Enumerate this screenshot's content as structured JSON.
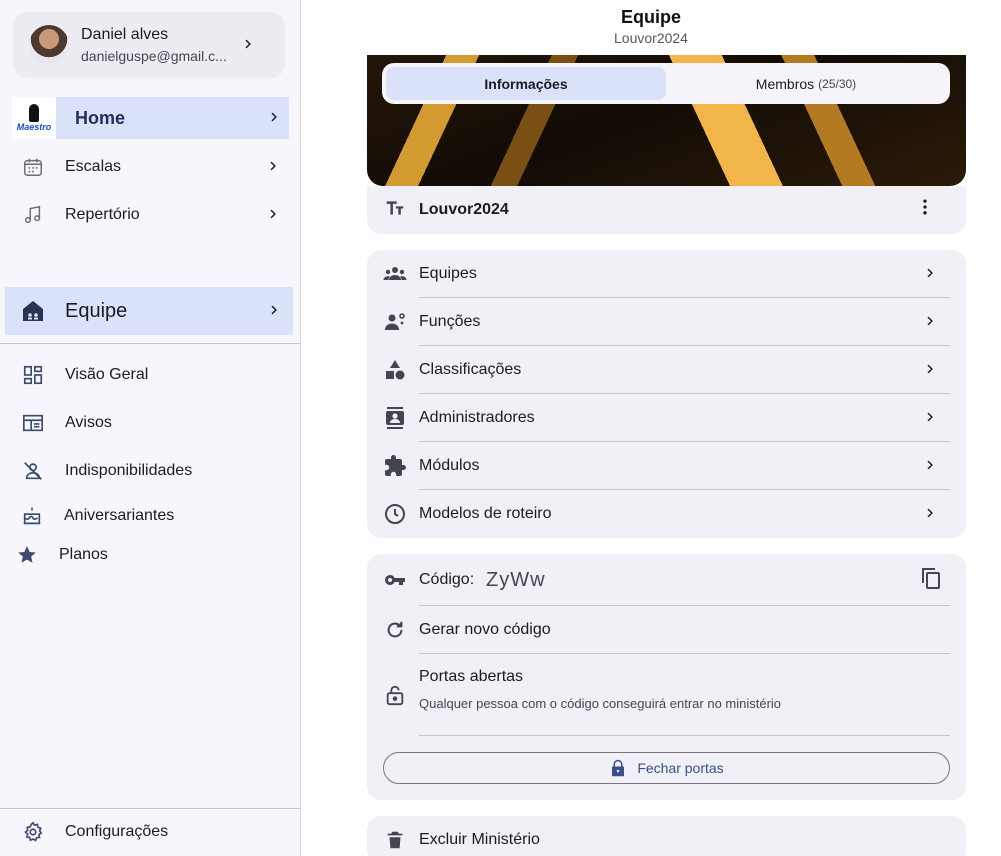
{
  "sidebar": {
    "profile": {
      "name": "Daniel alves",
      "email": "danielguspe@gmail.c..."
    },
    "home": {
      "logo_text": "Maestro",
      "label": "Home"
    },
    "items_top": [
      {
        "label": "Escalas",
        "icon": "calendar-icon"
      },
      {
        "label": "Repertório",
        "icon": "music-note-icon"
      }
    ],
    "equipe": {
      "label": "Equipe",
      "icon": "team-house-icon"
    },
    "items_bottom": [
      {
        "label": "Visão Geral",
        "icon": "dashboard-icon"
      },
      {
        "label": "Avisos",
        "icon": "newspaper-icon"
      },
      {
        "label": "Indisponibilidades",
        "icon": "person-off-icon"
      },
      {
        "label": "Aniversariantes",
        "icon": "cake-icon"
      },
      {
        "label": "Planos",
        "icon": "star-icon"
      }
    ],
    "settings": {
      "label": "Configurações",
      "icon": "gear-icon"
    }
  },
  "header": {
    "title": "Equipe",
    "subtitle": "Louvor2024"
  },
  "tabs": {
    "info": "Informações",
    "members": "Membros",
    "members_count": "(25/30)"
  },
  "team_name": "Louvor2024",
  "menu": [
    {
      "label": "Equipes",
      "icon": "groups-icon"
    },
    {
      "label": "Funções",
      "icon": "roles-icon"
    },
    {
      "label": "Classificações",
      "icon": "category-icon"
    },
    {
      "label": "Administradores",
      "icon": "contact-icon"
    },
    {
      "label": "Módulos",
      "icon": "puzzle-icon"
    },
    {
      "label": "Modelos de roteiro",
      "icon": "clock-icon"
    }
  ],
  "code": {
    "label": "Código:",
    "value": "ZyWw",
    "regenerate": "Gerar novo código",
    "open_title": "Portas abertas",
    "open_sub": "Qualquer pessoa com o código conseguirá entrar no ministério",
    "close_button": "Fechar portas"
  },
  "delete_label": "Excluir Ministério",
  "colors": {
    "accent_bg": "#dae2fa",
    "card_bg": "#f0f0f6",
    "sidebar_bg": "#f6f6fc"
  }
}
